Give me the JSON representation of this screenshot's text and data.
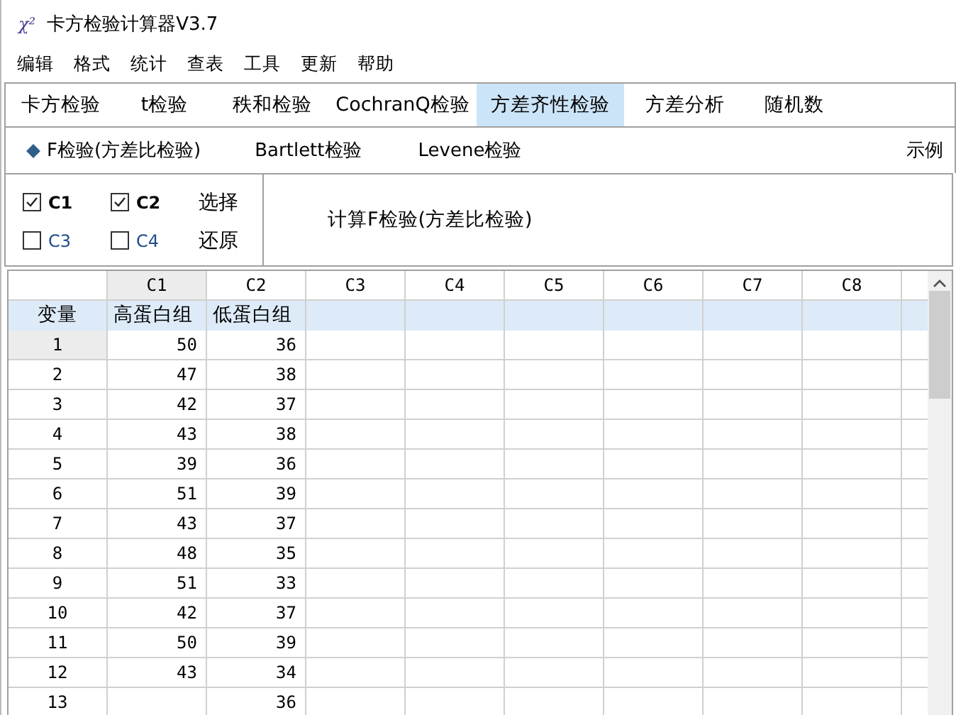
{
  "window": {
    "icon": "χ²",
    "title": "卡方检验计算器V3.7"
  },
  "menu": [
    "编辑",
    "格式",
    "统计",
    "查表",
    "工具",
    "更新",
    "帮助"
  ],
  "tabs": [
    {
      "label": "卡方检验",
      "selected": false
    },
    {
      "label": "t检验",
      "selected": false
    },
    {
      "label": "秩和检验",
      "selected": false
    },
    {
      "label": "CochranQ检验",
      "selected": false
    },
    {
      "label": "方差齐性检验",
      "selected": true
    },
    {
      "label": "方差分析",
      "selected": false
    },
    {
      "label": "随机数",
      "selected": false
    }
  ],
  "subtabs": [
    {
      "label": "F检验(方差比检验)",
      "selected": true
    },
    {
      "label": "Bartlett检验",
      "selected": false
    },
    {
      "label": "Levene检验",
      "selected": false
    }
  ],
  "example_link": "示例",
  "columns_select": [
    {
      "label": "C1",
      "checked": true
    },
    {
      "label": "C2",
      "checked": true
    },
    {
      "label": "C3",
      "checked": false
    },
    {
      "label": "C4",
      "checked": false
    }
  ],
  "select_buttons": [
    "选择",
    "还原"
  ],
  "compute_button": "计算F检验(方差比检验)",
  "table": {
    "corner": "变量",
    "columns": [
      {
        "label": "C1",
        "selected": true,
        "variable": "高蛋白组"
      },
      {
        "label": "C2",
        "selected": false,
        "variable": "低蛋白组"
      },
      {
        "label": "C3",
        "selected": false
      },
      {
        "label": "C4",
        "selected": false
      },
      {
        "label": "C5",
        "selected": false
      },
      {
        "label": "C6",
        "selected": false
      },
      {
        "label": "C7",
        "selected": false
      },
      {
        "label": "C8",
        "selected": false
      }
    ],
    "rows": [
      {
        "label": "1",
        "selected": true,
        "c1": "50",
        "c2": "36"
      },
      {
        "label": "2",
        "selected": false,
        "c1": "47",
        "c2": "38"
      },
      {
        "label": "3",
        "selected": false,
        "c1": "42",
        "c2": "37"
      },
      {
        "label": "4",
        "selected": false,
        "c1": "43",
        "c2": "38"
      },
      {
        "label": "5",
        "selected": false,
        "c1": "39",
        "c2": "36"
      },
      {
        "label": "6",
        "selected": false,
        "c1": "51",
        "c2": "39"
      },
      {
        "label": "7",
        "selected": false,
        "c1": "43",
        "c2": "37"
      },
      {
        "label": "8",
        "selected": false,
        "c1": "48",
        "c2": "35"
      },
      {
        "label": "9",
        "selected": false,
        "c1": "51",
        "c2": "33"
      },
      {
        "label": "10",
        "selected": false,
        "c1": "42",
        "c2": "37"
      },
      {
        "label": "11",
        "selected": false,
        "c1": "50",
        "c2": "39"
      },
      {
        "label": "12",
        "selected": false,
        "c1": "43",
        "c2": "34"
      },
      {
        "label": "13",
        "selected": false,
        "c2": "36"
      }
    ]
  }
}
